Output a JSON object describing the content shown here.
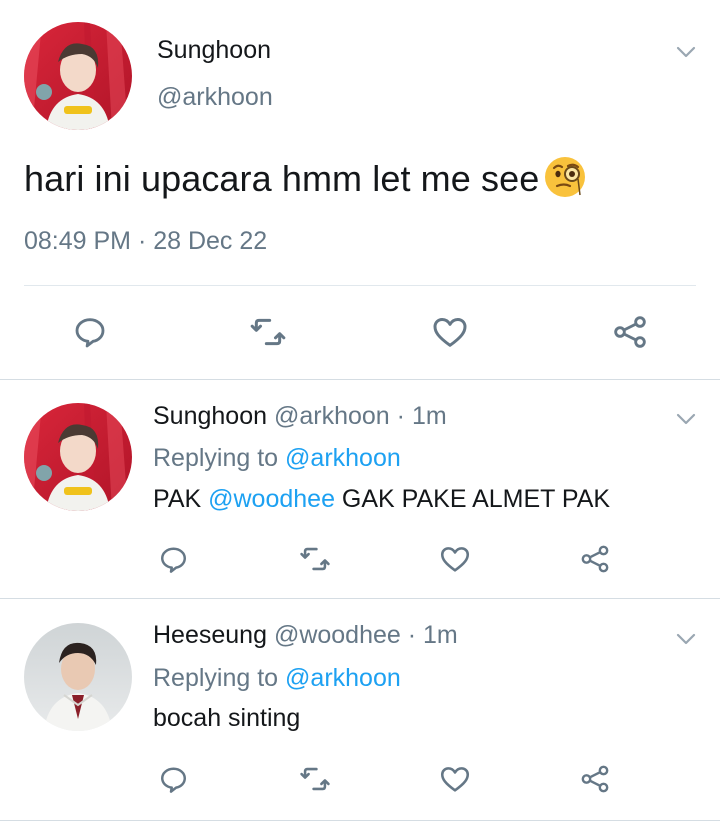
{
  "main_tweet": {
    "name": "Sunghoon",
    "handle": "@arkhoon",
    "text": "hari ini upacara hmm let me see",
    "emoji": "face-with-monocle",
    "timestamp": "08:49 PM · 28 Dec 22",
    "avatar": "profile-photo-red-background"
  },
  "replies": [
    {
      "name": "Sunghoon",
      "handle": "@arkhoon",
      "separator": "·",
      "time": "1m",
      "replying_label": "Replying to",
      "replying_handle": "@arkhoon",
      "text_before": "PAK ",
      "mention": "@woodhee",
      "text_after": " GAK PAKE ALMET PAK",
      "avatar": "profile-photo-red-background"
    },
    {
      "name": "Heeseung",
      "handle": "@woodhee",
      "separator": "·",
      "time": "1m",
      "replying_label": "Replying to",
      "replying_handle": "@arkhoon",
      "text": "bocah sinting",
      "avatar": "profile-photo-light-background"
    }
  ],
  "colors": {
    "text": "#14171a",
    "secondary": "#657786",
    "link": "#1da1f2",
    "icon": "#657786",
    "divider": "#e1e8ed"
  },
  "icons": [
    "reply-icon",
    "retweet-icon",
    "like-icon",
    "share-icon",
    "chevron-down-icon"
  ]
}
